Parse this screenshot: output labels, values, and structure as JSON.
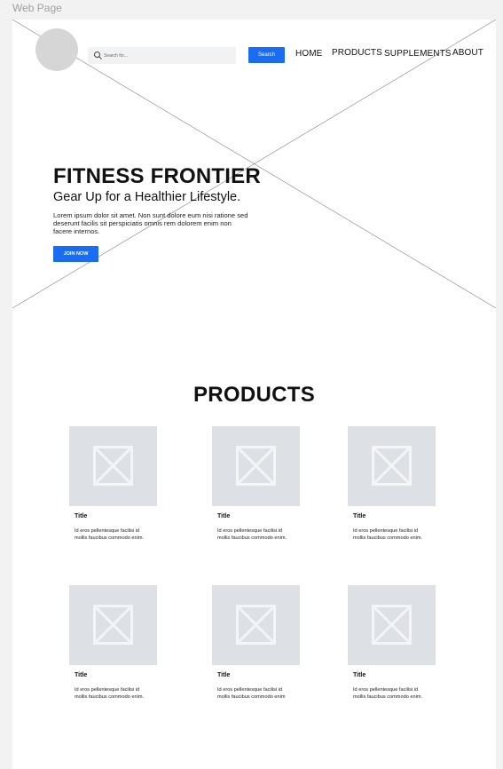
{
  "frame_label": "Web Page",
  "header": {
    "search_placeholder": "Search for...",
    "search_button": "Search",
    "nav": [
      "HOME",
      "PRODUCTS",
      "SUPPLEMENTS",
      "ABOUT"
    ]
  },
  "hero": {
    "title": "FITNESS FRONTIER",
    "subtitle": "Gear Up for a Healthier Lifestyle.",
    "body": "Lorem ipsum dolor sit amet. Non sunt dolore eum nisi ratione sed deserunt facilis sit perspiciatis omnis rem dolorem enim non facere internos.",
    "cta": "JOIN NOW"
  },
  "products": {
    "heading": "PRODUCTS",
    "items": [
      {
        "title": "Title",
        "description": "Id eros pellentesque facilisi id mollis faucibus commodo enim."
      },
      {
        "title": "Title",
        "description": "Id eros pellentesque facilisi id mollis faucibus commodo enim."
      },
      {
        "title": "Title",
        "description": "Id eros pellentesque facilisi id mollis faucibus commodo enim."
      },
      {
        "title": "Title",
        "description": "Id eros pellentesque facilisi id mollis faucibus commodo enim."
      },
      {
        "title": "Title",
        "description": "Id eros pellentesque facilisi id mollis faucibus commodo enim"
      },
      {
        "title": "Title",
        "description": "Id eros pellentesque facilisi id mollis faucibus commodo enim."
      }
    ]
  },
  "colors": {
    "accent": "#1a6df3",
    "placeholder_image": "#dde0e4",
    "logo_placeholder": "#d6d6d6",
    "canvas_background": "#f2f2f2"
  },
  "icons": {
    "logo": "logo-placeholder-circle",
    "search": "search-icon",
    "card_image": "image-placeholder-icon",
    "hero_background": "image-placeholder-cross"
  }
}
